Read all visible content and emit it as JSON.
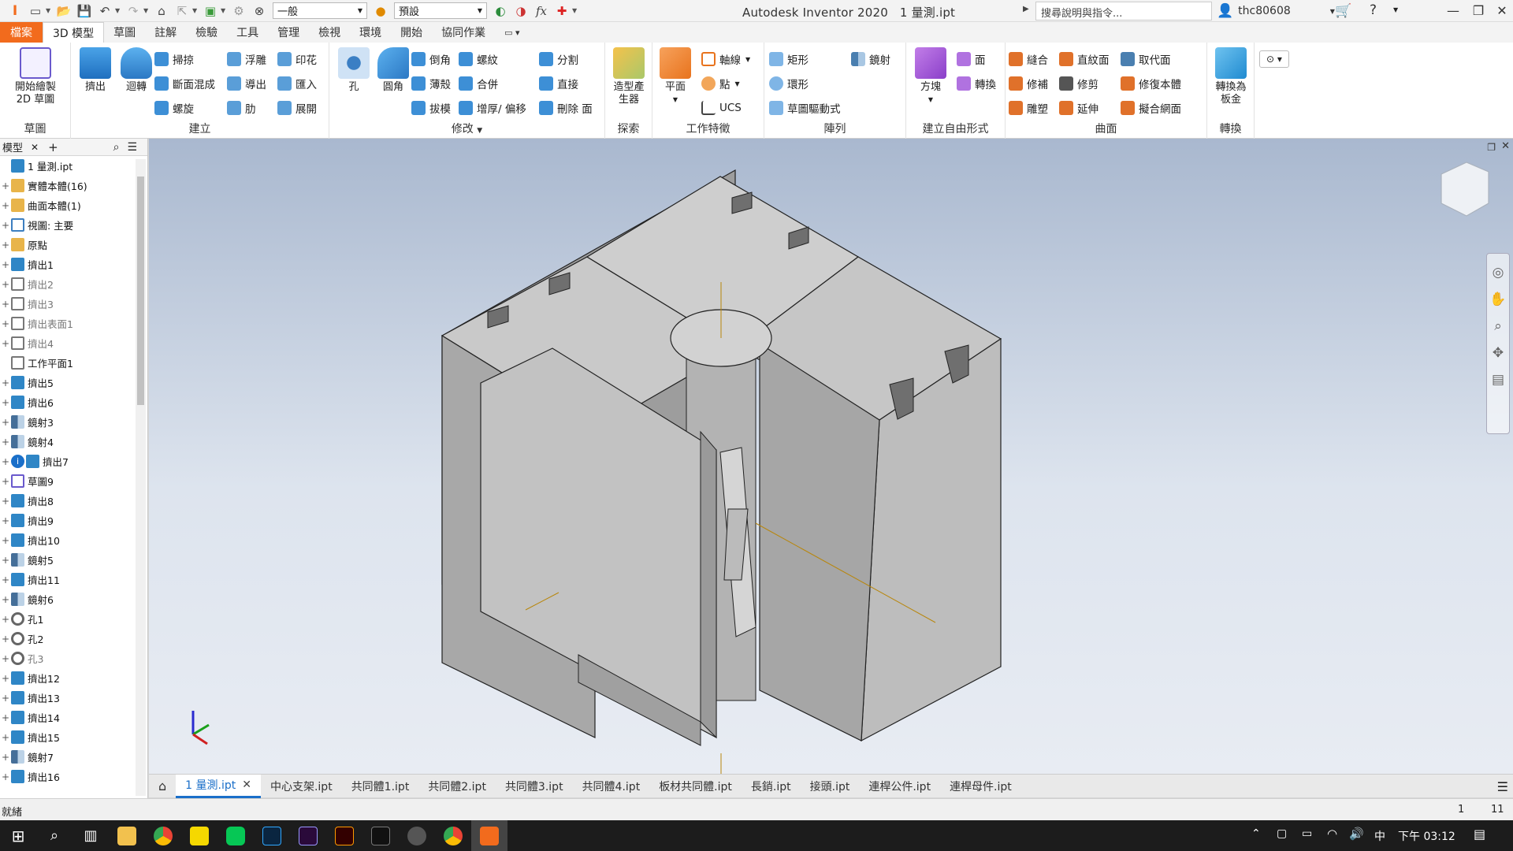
{
  "app": {
    "title": "Autodesk Inventor 2020",
    "document": "1 量測.ipt",
    "style_combo": "一般",
    "appearance_combo": "預設",
    "search_placeholder": "搜尋說明與指令...",
    "user": "thc80608"
  },
  "ribbon_tabs": [
    "檔案",
    "3D 模型",
    "草圖",
    "註解",
    "檢驗",
    "工具",
    "管理",
    "檢視",
    "環境",
    "開始",
    "協同作業"
  ],
  "ribbon": {
    "sketch_panel": {
      "button": "開始繪製 2D 草圖",
      "label": "草圖"
    },
    "create_panel": {
      "extrude": "擠出",
      "revolve": "迴轉",
      "sweep": "掃掠",
      "loft": "斷面混成",
      "coil": "螺旋",
      "emboss": "浮雕",
      "derive": "導出",
      "rib": "肋",
      "decal": "印花",
      "import": "匯入",
      "unwrap": "展開",
      "label": "建立"
    },
    "modify_panel": {
      "hole": "孔",
      "fillet": "圓角",
      "chamfer": "倒角",
      "shell": "薄殼",
      "draft": "拔模",
      "thread": "螺紋",
      "combine": "合併",
      "thicken": "增厚/ 偏移",
      "split": "分割",
      "direct": "直接",
      "delete_face": "刪除 面",
      "label": "修改"
    },
    "explore_panel": {
      "shape_generator": "造型產生器",
      "label": "探索"
    },
    "work_features_panel": {
      "plane": "平面",
      "axis": "軸線",
      "point": "點",
      "ucs": "UCS",
      "label": "工作特徵"
    },
    "pattern_panel": {
      "rect": "矩形",
      "circ": "環形",
      "sketch_driven": "草圖驅動式",
      "mirror": "鏡射",
      "label": "陣列"
    },
    "freeform_panel": {
      "box": "方塊",
      "face": "面",
      "convert": "轉換",
      "label": "建立自由形式"
    },
    "surface_panel": {
      "stitch": "縫合",
      "patch": "修補",
      "sculpt": "雕塑",
      "ruled": "直紋面",
      "trim": "修剪",
      "extend": "延伸",
      "replace": "取代面",
      "repair": "修復本體",
      "fit_mesh": "擬合網面",
      "label": "曲面"
    },
    "convert_panel": {
      "to_sheet": "轉換為 板金",
      "label": "轉換"
    }
  },
  "browser": {
    "tab": "模型",
    "items": [
      {
        "label": "1 量測.ipt",
        "icon": "part-icon",
        "dim": false,
        "exp": ""
      },
      {
        "label": "實體本體(16)",
        "icon": "folder-icon",
        "dim": false,
        "exp": "+"
      },
      {
        "label": "曲面本體(1)",
        "icon": "folder-icon",
        "dim": false,
        "exp": "+"
      },
      {
        "label": "視圖: 主要",
        "icon": "view-icon",
        "dim": false,
        "exp": "+"
      },
      {
        "label": "原點",
        "icon": "folder-icon",
        "dim": false,
        "exp": "+"
      },
      {
        "label": "擠出1",
        "icon": "extrude-icon",
        "dim": false,
        "exp": "+"
      },
      {
        "label": "擠出2",
        "icon": "extrude-outline-icon",
        "dim": true,
        "exp": "+"
      },
      {
        "label": "擠出3",
        "icon": "extrude-outline-icon",
        "dim": true,
        "exp": "+"
      },
      {
        "label": "擠出表面1",
        "icon": "extrude-outline-icon",
        "dim": true,
        "exp": "+"
      },
      {
        "label": "擠出4",
        "icon": "extrude-outline-icon",
        "dim": true,
        "exp": "+"
      },
      {
        "label": "工作平面1",
        "icon": "workplane-icon",
        "dim": false,
        "exp": ""
      },
      {
        "label": "擠出5",
        "icon": "extrude-icon",
        "dim": false,
        "exp": "+"
      },
      {
        "label": "擠出6",
        "icon": "extrude-icon",
        "dim": false,
        "exp": "+"
      },
      {
        "label": "鏡射3",
        "icon": "mirror-icon",
        "dim": false,
        "exp": "+"
      },
      {
        "label": "鏡射4",
        "icon": "mirror-icon",
        "dim": false,
        "exp": "+"
      },
      {
        "label": "擠出7",
        "icon": "extrude-icon",
        "dim": false,
        "exp": "+",
        "info": true
      },
      {
        "label": "草圖9",
        "icon": "sketch-icon",
        "dim": false,
        "exp": "+"
      },
      {
        "label": "擠出8",
        "icon": "extrude-icon",
        "dim": false,
        "exp": "+"
      },
      {
        "label": "擠出9",
        "icon": "extrude-icon",
        "dim": false,
        "exp": "+"
      },
      {
        "label": "擠出10",
        "icon": "extrude-icon",
        "dim": false,
        "exp": "+"
      },
      {
        "label": "鏡射5",
        "icon": "mirror-icon",
        "dim": false,
        "exp": "+"
      },
      {
        "label": "擠出11",
        "icon": "extrude-icon",
        "dim": false,
        "exp": "+"
      },
      {
        "label": "鏡射6",
        "icon": "mirror-icon",
        "dim": false,
        "exp": "+"
      },
      {
        "label": "孔1",
        "icon": "hole-icon",
        "dim": false,
        "exp": "+"
      },
      {
        "label": "孔2",
        "icon": "hole-icon",
        "dim": false,
        "exp": "+"
      },
      {
        "label": "孔3",
        "icon": "hole-icon",
        "dim": true,
        "exp": "+"
      },
      {
        "label": "擠出12",
        "icon": "extrude-icon",
        "dim": false,
        "exp": "+"
      },
      {
        "label": "擠出13",
        "icon": "extrude-icon",
        "dim": false,
        "exp": "+"
      },
      {
        "label": "擠出14",
        "icon": "extrude-icon",
        "dim": false,
        "exp": "+"
      },
      {
        "label": "擠出15",
        "icon": "extrude-icon",
        "dim": false,
        "exp": "+"
      },
      {
        "label": "鏡射7",
        "icon": "mirror-icon",
        "dim": false,
        "exp": "+"
      },
      {
        "label": "擠出16",
        "icon": "extrude-icon",
        "dim": false,
        "exp": "+"
      }
    ]
  },
  "doc_tabs": [
    "1 量測.ipt",
    "中心支架.ipt",
    "共同體1.ipt",
    "共同體2.ipt",
    "共同體3.ipt",
    "共同體4.ipt",
    "板材共同體.ipt",
    "長銷.ipt",
    "接頭.ipt",
    "連桿公件.ipt",
    "連桿母件.ipt"
  ],
  "status": {
    "text": "就緒",
    "count1": "1",
    "count2": "11"
  },
  "taskbar": {
    "ime": "中",
    "time": "下午 03:12"
  },
  "colors": {
    "file_tab": "#f26b1d",
    "accent": "#1a6fc9",
    "viewport_top": "#a9b8cf",
    "viewport_bottom": "#e8ecf3"
  }
}
